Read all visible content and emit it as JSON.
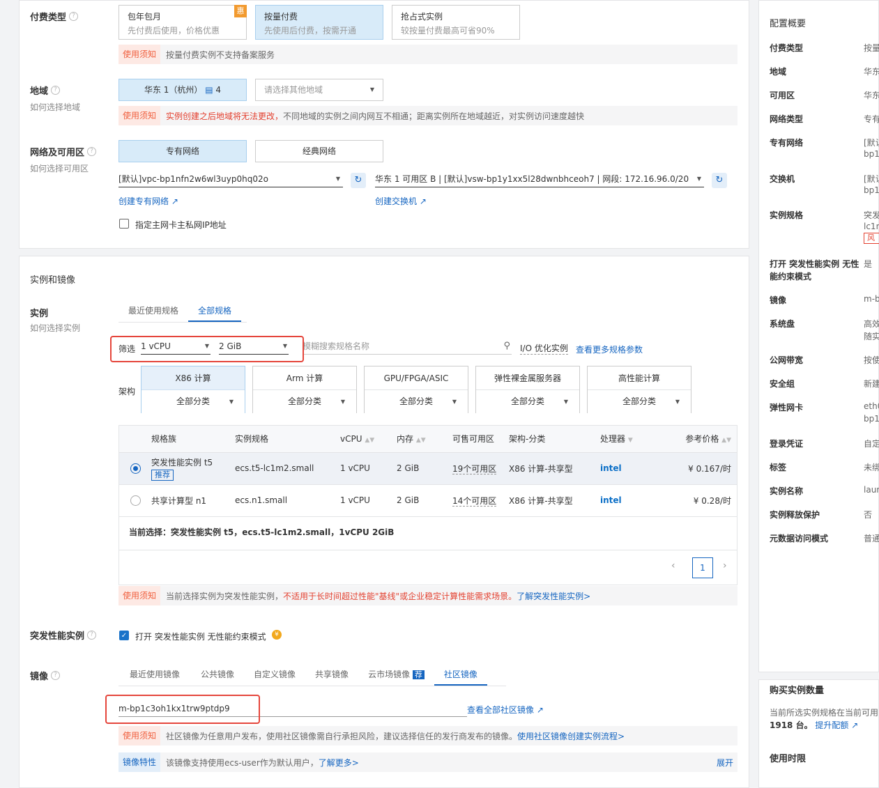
{
  "billing": {
    "label": "付费类型",
    "options": [
      {
        "title": "包年包月",
        "desc": "先付费后使用，价格优惠",
        "badge": "惠"
      },
      {
        "title": "按量付费",
        "desc": "先使用后付费，按需开通"
      },
      {
        "title": "抢占式实例",
        "desc": "较按量付费最高可省90%"
      }
    ],
    "notice_tag": "使用须知",
    "notice_text": "按量付费实例不支持备案服务"
  },
  "region": {
    "label": "地域",
    "sub": "如何选择地域",
    "selected": "华东 1（杭州）",
    "selected_count": "4",
    "placeholder": "请选择其他地域",
    "notice_tag": "使用须知",
    "notice_red": "实例创建之后地域将无法更改，",
    "notice_text": "不同地域的实例之间内网互不相通；距离实例所在地域越近，对实例访问速度越快"
  },
  "network": {
    "label": "网络及可用区",
    "sub": "如何选择可用区",
    "vpc_btn": "专有网络",
    "classic_btn": "经典网络",
    "vpc_value": "[默认]vpc-bp1nfn2w6wl3uyp0hq02o",
    "vswitch_value": "华东 1 可用区 B | [默认]vsw-bp1y1xx5l28dwnbhceoh7 | 网段: 172.16.96.0/20",
    "create_vpc": "创建专有网络",
    "create_vswitch": "创建交换机",
    "private_ip_label": "指定主网卡主私网IP地址"
  },
  "section2_title": "实例和镜像",
  "instance": {
    "label": "实例",
    "sub": "如何选择实例",
    "tabs": [
      "最近使用规格",
      "全部规格"
    ],
    "filter_label": "筛选",
    "vcpu": "1 vCPU",
    "mem": "2 GiB",
    "search_placeholder": "模糊搜索规格名称",
    "io_label": "I/O 优化实例",
    "more_params": "查看更多规格参数",
    "arch_label": "架构",
    "archs": [
      {
        "name": "X86 计算",
        "sub": "全部分类"
      },
      {
        "name": "Arm 计算",
        "sub": "全部分类"
      },
      {
        "name": "GPU/FPGA/ASIC",
        "sub": "全部分类"
      },
      {
        "name": "弹性裸金属服务器",
        "sub": "全部分类"
      },
      {
        "name": "高性能计算",
        "sub": "全部分类"
      }
    ],
    "columns": [
      "规格族",
      "实例规格",
      "vCPU",
      "内存",
      "可售可用区",
      "架构-分类",
      "处理器",
      "参考价格"
    ],
    "rows": [
      {
        "family": "突发性能实例 t5",
        "badge": "推荐",
        "spec": "ecs.t5-lc1m2.small",
        "vcpu": "1 vCPU",
        "mem": "2 GiB",
        "zones": "19个可用区",
        "arch": "X86 计算-共享型",
        "cpu": "intel",
        "price": "¥ 0.167",
        "unit": "/时"
      },
      {
        "family": "共享计算型 n1",
        "spec": "ecs.n1.small",
        "vcpu": "1 vCPU",
        "mem": "2 GiB",
        "zones": "14个可用区",
        "arch": "X86 计算-共享型",
        "cpu": "intel",
        "price": "¥ 0.28",
        "unit": "/时"
      }
    ],
    "current_selection": "当前选择：突发性能实例 t5，ecs.t5-lc1m2.small，1vCPU 2GiB",
    "page": "1",
    "notice_tag": "使用须知",
    "notice_text": "当前选择实例为突发性能实例，",
    "notice_red": "不适用于长时间超过性能\"基线\"或企业稳定计算性能需求场景。",
    "notice_link": "了解突发性能实例>"
  },
  "burst": {
    "label": "突发性能实例",
    "checkbox_label": "打开 突发性能实例 无性能约束模式",
    "coin": "¥"
  },
  "image": {
    "label": "镜像",
    "tabs": [
      "最近使用镜像",
      "公共镜像",
      "自定义镜像",
      "共享镜像",
      "云市场镜像",
      "社区镜像"
    ],
    "market_badge": "荐",
    "value": "m-bp1c3oh1kx1trw9ptdp9",
    "view_all": "查看全部社区镜像",
    "notice_tag": "使用须知",
    "notice_text": "社区镜像为任意用户发布，使用社区镜像需自行承担风险，建议选择信任的发行商发布的镜像。",
    "notice_link": "使用社区镜像创建实例流程>",
    "feature_tag": "镜像特性",
    "feature_text": "该镜像支持使用ecs-user作为默认用户，",
    "feature_link": "了解更多>",
    "expand": "展开"
  },
  "summary": {
    "title": "配置概要",
    "rows": [
      {
        "k": "付费类型",
        "v": "按量"
      },
      {
        "k": "地域",
        "v": "华东"
      },
      {
        "k": "可用区",
        "v": "华东"
      },
      {
        "k": "网络类型",
        "v": "专有"
      },
      {
        "k": "专有网络",
        "v": "[默认",
        "v2": "bp1"
      },
      {
        "k": "交换机",
        "v": "[默认",
        "v2": "bp1"
      },
      {
        "k": "实例规格",
        "v": "突发",
        "v2": "lc1m",
        "tag": "风"
      },
      {
        "k": "打开 突发性能实例 无性能约束模式",
        "v": "是"
      },
      {
        "k": "镜像",
        "v": "m-b"
      },
      {
        "k": "系统盘",
        "v": "高效",
        "v2": "随实"
      },
      {
        "k": "公网带宽",
        "v": "按使"
      },
      {
        "k": "安全组",
        "v": "新建"
      },
      {
        "k": "弹性网卡",
        "v": "eth0",
        "v2": "bp1"
      },
      {
        "k": "登录凭证",
        "v": "自定"
      },
      {
        "k": "标签",
        "v": "未绑"
      },
      {
        "k": "实例名称",
        "v": "laun"
      },
      {
        "k": "实例释放保护",
        "v": "否"
      },
      {
        "k": "元数据访问模式",
        "v": "普通"
      }
    ]
  },
  "purchase": {
    "title": "购买实例数量",
    "text": "当前所选实例规格在当前可用区",
    "count": "1918 台。",
    "link": "提升配额",
    "usage": "使用时限"
  },
  "colors": {
    "accent": "#1565c0",
    "warn": "#f0603f",
    "highlight": "#e5453b"
  }
}
